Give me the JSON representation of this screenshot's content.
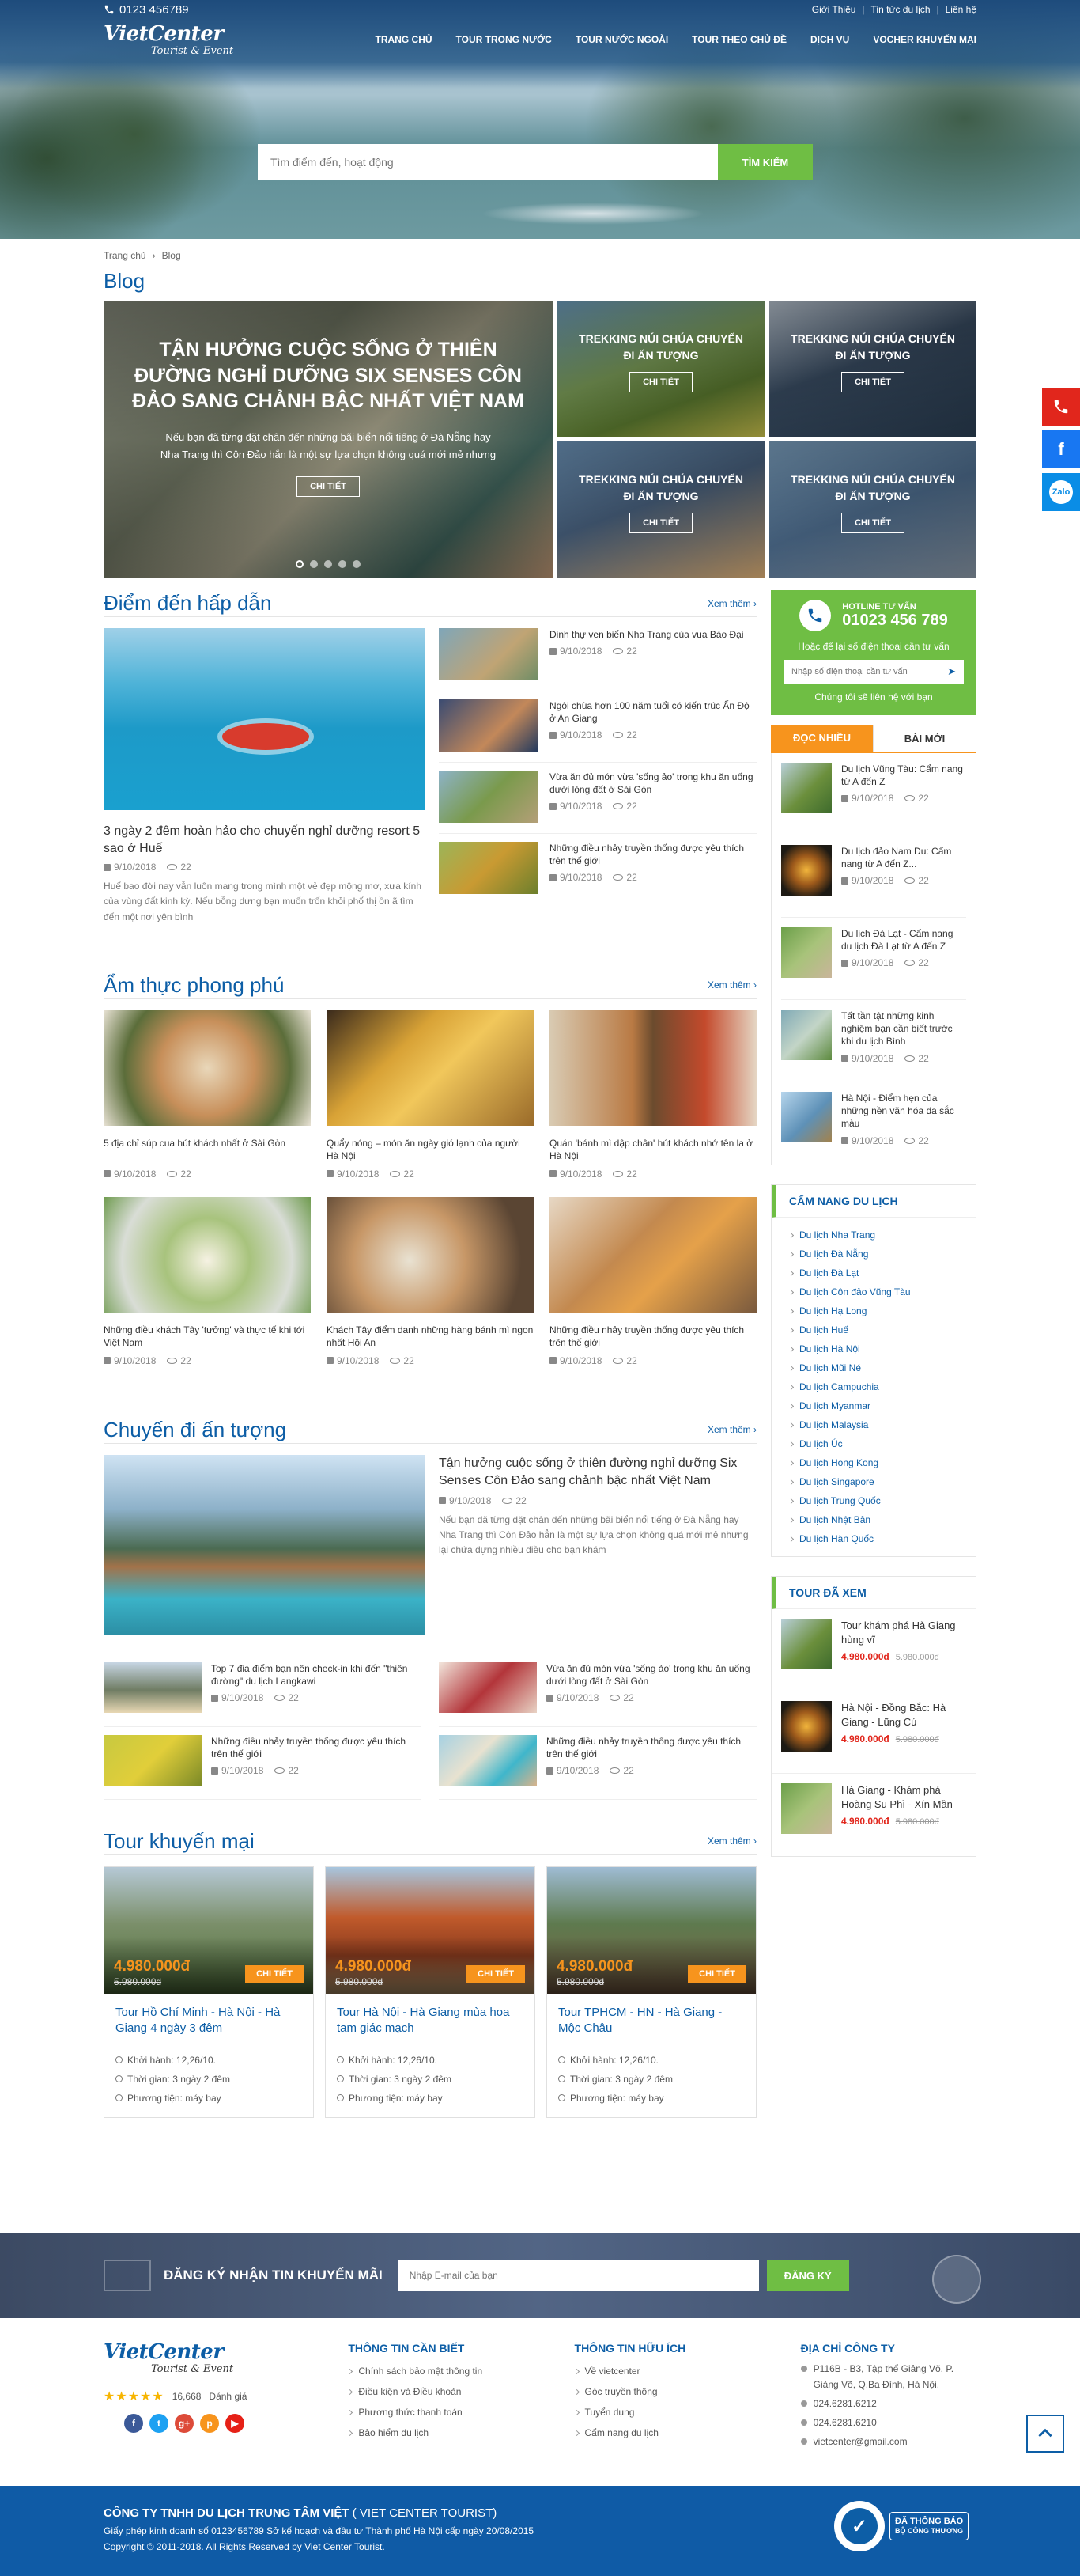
{
  "topbar": {
    "phone": "0123 456789",
    "links": [
      "Giới Thiệu",
      "Tin tức du lịch",
      "Liên hệ"
    ]
  },
  "logo": {
    "name": "VietCenter",
    "tagline": "Tourist & Event"
  },
  "nav": [
    "TRANG CHỦ",
    "TOUR TRONG NƯỚC",
    "TOUR NƯỚC NGOÀI",
    "TOUR THEO CHỦ ĐỀ",
    "DỊCH VỤ",
    "VOCHER KHUYẾN MẠI"
  ],
  "search": {
    "placeholder": "Tìm điểm đến, hoạt động",
    "button": "TÌM KIẾM"
  },
  "breadcrumb": {
    "home": "Trang chủ",
    "current": "Blog"
  },
  "page_title": "Blog",
  "featured": {
    "title": "TẬN HƯỞNG CUỘC SỐNG Ở THIÊN ĐƯỜNG NGHỈ DƯỠNG SIX SENSES CÔN ĐẢO SANG CHẢNH BẬC NHẤT VIỆT NAM",
    "excerpt": "Nếu bạn đã từng đặt chân đến những bãi biển nổi tiếng ở Đà Nẵng hay Nha Trang thì Côn Đảo hẳn là một sự lựa chọn không quá mới mẻ nhưng",
    "button": "CHI TIẾT",
    "tiles": [
      {
        "title": "TREKKING NÚI CHÚA CHUYẾN ĐI ẤN TƯỢNG",
        "button": "CHI TIẾT"
      },
      {
        "title": "TREKKING NÚI CHÚA CHUYẾN ĐI ẤN TƯỢNG",
        "button": "CHI TIẾT"
      },
      {
        "title": "TREKKING NÚI CHÚA CHUYẾN ĐI ẤN TƯỢNG",
        "button": "CHI TIẾT"
      },
      {
        "title": "TREKKING NÚI CHÚA CHUYẾN ĐI ẤN TƯỢNG",
        "button": "CHI TIẾT"
      }
    ]
  },
  "destinations": {
    "title": "Điểm đến hấp dẫn",
    "more": "Xem thêm ›",
    "main": {
      "title": "3 ngày 2 đêm hoàn hảo cho chuyến nghỉ dưỡng resort 5 sao ở Huế",
      "date": "9/10/2018",
      "views": "22",
      "excerpt": "Huế bao đời nay vẫn luôn mang trong mình một vẻ đẹp mộng mơ, xưa kính của vùng đất kinh kỳ. Nếu bỗng dưng bạn muốn trốn khỏi phố thị ồn ã tìm đến một nơi yên bình"
    },
    "items": [
      {
        "title": "Dinh thự ven biển Nha Trang của vua Bảo Đại",
        "date": "9/10/2018",
        "views": "22"
      },
      {
        "title": "Ngôi chùa hơn 100 năm tuổi có kiến trúc Ấn Độ ở An Giang",
        "date": "9/10/2018",
        "views": "22"
      },
      {
        "title": "Vừa ăn đủ món vừa 'sống ảo' trong khu ăn uống dưới lòng đất ở Sài Gòn",
        "date": "9/10/2018",
        "views": "22"
      },
      {
        "title": "Những điều nhảy truyền thống được yêu thích trên thế giới",
        "date": "9/10/2018",
        "views": "22"
      }
    ]
  },
  "food": {
    "title": "Ẩm thực phong phú",
    "more": "Xem thêm ›",
    "items": [
      {
        "title": "5 địa chỉ súp cua hút khách nhất ở Sài Gòn",
        "date": "9/10/2018",
        "views": "22"
      },
      {
        "title": "Quẩy nóng – món ăn ngày gió lạnh của người Hà Nội",
        "date": "9/10/2018",
        "views": "22"
      },
      {
        "title": "Quán 'bánh mì dập chân' hút khách nhớ tên la ở Hà Nội",
        "date": "9/10/2018",
        "views": "22"
      },
      {
        "title": "Những điều khách Tây 'tưởng' và thực tế khi tới Việt Nam",
        "date": "9/10/2018",
        "views": "22"
      },
      {
        "title": "Khách Tây điểm danh những hàng bánh mì ngon nhất Hội An",
        "date": "9/10/2018",
        "views": "22"
      },
      {
        "title": "Những điều nhảy truyền thống được yêu thích trên thế giới",
        "date": "9/10/2018",
        "views": "22"
      }
    ]
  },
  "trips": {
    "title": "Chuyến đi ấn tượng",
    "more": "Xem thêm ›",
    "main": {
      "title": "Tận hưởng cuộc sống ở thiên đường nghỉ dưỡng Six Senses Côn Đảo sang chảnh bậc nhất Việt Nam",
      "date": "9/10/2018",
      "views": "22",
      "excerpt": "Nếu bạn đã từng đặt chân đến những bãi biển nổi tiếng ở Đà Nẵng hay Nha Trang thì Côn Đảo hẳn là một sự lựa chọn không quá mới mẻ nhưng lại chứa đựng nhiều điều cho bạn khám"
    },
    "items": [
      {
        "title": "Top 7 địa điểm bạn nên check-in khi đến \"thiên đường\" du lịch Langkawi",
        "date": "9/10/2018",
        "views": "22"
      },
      {
        "title": "Vừa ăn đủ món vừa 'sống ảo' trong khu ăn uống dưới lòng đất ở Sài Gòn",
        "date": "9/10/2018",
        "views": "22"
      },
      {
        "title": "Những điều nhảy truyền thống được yêu thích trên thế giới",
        "date": "9/10/2018",
        "views": "22"
      },
      {
        "title": "Những điều nhảy truyền thống được yêu thích trên thế giới",
        "date": "9/10/2018",
        "views": "22"
      }
    ]
  },
  "promo": {
    "title": "Tour khuyến mại",
    "more": "Xem thêm ›",
    "cards": [
      {
        "price": "4.980.000đ",
        "old": "5.980.000đ",
        "button": "CHI TIẾT",
        "title": "Tour Hồ Chí Minh - Hà Nội - Hà Giang 4 ngày 3 đêm",
        "depart": "Khởi hành: 12,26/10.",
        "time": "Thời gian: 3 ngày 2 đêm",
        "transport": "Phương tiện:  máy bay"
      },
      {
        "price": "4.980.000đ",
        "old": "5.980.000đ",
        "button": "CHI TIẾT",
        "title": "Tour Hà Nội - Hà Giang mùa hoa tam giác mạch",
        "depart": "Khởi hành: 12,26/10.",
        "time": "Thời gian: 3 ngày 2 đêm",
        "transport": "Phương tiện:  máy bay"
      },
      {
        "price": "4.980.000đ",
        "old": "5.980.000đ",
        "button": "CHI TIẾT",
        "title": "Tour TPHCM - HN - Hà Giang - Mộc Châu",
        "depart": "Khởi hành: 12,26/10.",
        "time": "Thời gian: 3 ngày 2 đêm",
        "transport": "Phương tiện:  máy bay"
      }
    ]
  },
  "sidebar": {
    "hotline_label": "HOTLINE TƯ VẤN",
    "hotline": "01023 456 789",
    "note": "Hoặc để lại số điện thoại cần tư vấn",
    "phone_placeholder": "Nhập số điện thoại cần tư vấn",
    "callback": "Chúng tôi sẽ liên hệ với bạn",
    "tab_popular": "ĐỌC NHIỀU",
    "tab_new": "BÀI MỚI",
    "popular": [
      {
        "title": "Du lịch Vũng Tàu: Cẩm nang từ A đến Z",
        "date": "9/10/2018",
        "views": "22"
      },
      {
        "title": "Du lịch đảo Nam Du: Cẩm nang từ A đến Z...",
        "date": "9/10/2018",
        "views": "22"
      },
      {
        "title": "Du lịch Đà Lạt - Cẩm nang du lịch Đà Lạt từ A đến Z",
        "date": "9/10/2018",
        "views": "22"
      },
      {
        "title": "Tất tần tật những kinh nghiệm bạn cần biết trước khi du lịch Bình",
        "date": "9/10/2018",
        "views": "22"
      },
      {
        "title": "Hà Nội - Điểm hẹn của những nền văn hóa đa sắc màu",
        "date": "9/10/2018",
        "views": "22"
      }
    ],
    "guide_title": "CẨM NANG DU LỊCH",
    "guide": [
      "Du lịch Nha Trang",
      "Du lịch Đà Nẵng",
      "Du lịch Đà Lạt",
      "Du lịch Côn đảo Vũng Tàu",
      "Du lịch Hạ Long",
      "Du lịch Huế",
      "Du lịch Hà Nội",
      "Du lịch Mũi Né",
      "Du lịch Campuchia",
      "Du lịch Myanmar",
      "Du lịch Malaysia",
      "Du lịch Úc",
      "Du lịch Hong Kong",
      "Du lịch Singapore",
      "Du lịch Trung Quốc",
      "Du lịch Nhật Bản",
      "Du lịch Hàn Quốc"
    ],
    "viewed_title": "TOUR ĐÃ XEM",
    "viewed": [
      {
        "title": "Tour khám phá Hà Giang hùng vĩ",
        "price": "4.980.000đ",
        "old": "5.980.000đ"
      },
      {
        "title": "Hà Nội - Đồng Bắc: Hà Giang - Lũng Cú",
        "price": "4.980.000đ",
        "old": "5.980.000đ"
      },
      {
        "title": "Hà Giang - Khám phá Hoàng Su Phì - Xín Mần",
        "price": "4.980.000đ",
        "old": "5.980.000đ"
      }
    ]
  },
  "newsletter": {
    "label": "ĐĂNG KÝ NHẬN TIN KHUYẾN MÃI",
    "placeholder": "Nhập E-mail của bạn",
    "button": "ĐĂNG KÝ"
  },
  "footer": {
    "rating_count": "16,668",
    "rating_label": "Đánh giá",
    "social": [
      "f",
      "t",
      "g+",
      "p",
      "▶"
    ],
    "col1_title": "THÔNG TIN CẦN BIẾT",
    "col1": [
      "Chính sách bảo mật thông tin",
      "Điều kiện và Điều khoản",
      "Phương thức thanh toán",
      "Bảo hiểm du lịch"
    ],
    "col2_title": "THÔNG TIN HỮU ÍCH",
    "col2": [
      "Về vietcenter",
      "Góc truyền thông",
      "Tuyển dụng",
      "Cẩm nang du lịch"
    ],
    "col3_title": "ĐỊA CHỈ CÔNG TY",
    "col3": [
      "P116B - B3, Tập thể Giảng Võ, P. Giảng Võ, Q.Ba Đình, Hà Nội.",
      "024.6281.6212",
      "024.6281.6210",
      "vietcenter@gmail.com"
    ]
  },
  "bottom": {
    "company": "CÔNG TY TNHH DU LỊCH TRUNG TÂM VIỆT",
    "company_en": "( VIET CENTER TOURIST)",
    "license": "Giấy phép kinh doanh số 0123456789  Sở kế hoạch và đầu tư Thành phố Hà Nội cấp ngày 20/08/2015",
    "copyright": "Copyright © 2011-2018. All Rights Reserved by Viet Center Tourist.",
    "badge_line1": "ĐÃ THÔNG BÁO",
    "badge_line2": "BỘ CÔNG THƯƠNG"
  },
  "floating": {
    "zalo": "Zalo",
    "facebook": "f"
  },
  "colors": {
    "brand_blue": "#0d5ea6",
    "green": "#6fbe44",
    "orange": "#f7941d",
    "red_price": "#e1261c"
  }
}
